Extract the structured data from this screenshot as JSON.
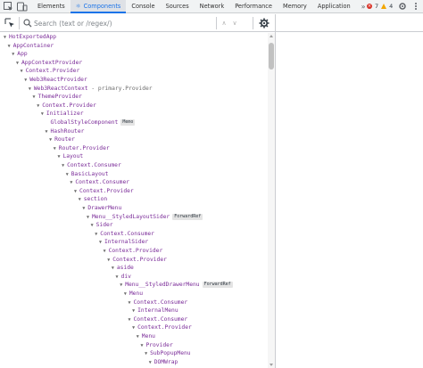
{
  "tabs": [
    {
      "label": "Elements",
      "active": false
    },
    {
      "label": "Components",
      "active": true
    },
    {
      "label": "Console",
      "active": false
    },
    {
      "label": "Sources",
      "active": false
    },
    {
      "label": "Network",
      "active": false
    },
    {
      "label": "Performance",
      "active": false
    },
    {
      "label": "Memory",
      "active": false
    },
    {
      "label": "Application",
      "active": false
    }
  ],
  "overflow_label": "»",
  "counts": {
    "errors": "7",
    "warnings": "4"
  },
  "search": {
    "placeholder": "Search (text or /regex/)",
    "value": ""
  },
  "tree": [
    {
      "name": "HotExportedApp",
      "depth": 0,
      "expanded": true
    },
    {
      "name": "AppContainer",
      "depth": 1,
      "expanded": true
    },
    {
      "name": "App",
      "depth": 2,
      "expanded": true
    },
    {
      "name": "AppContextProvider",
      "depth": 3,
      "expanded": true
    },
    {
      "name": "Context.Provider",
      "depth": 4,
      "expanded": true
    },
    {
      "name": "Web3ReactProvider",
      "depth": 5,
      "expanded": true
    },
    {
      "name": "Web3ReactContext",
      "extra": " - primary.Provider",
      "depth": 6,
      "expanded": true
    },
    {
      "name": "ThemeProvider",
      "depth": 7,
      "expanded": true
    },
    {
      "name": "Context.Provider",
      "depth": 8,
      "expanded": true
    },
    {
      "name": "Initializer",
      "depth": 9,
      "expanded": true
    },
    {
      "name": "GlobalStyleComponent",
      "badge": "Memo",
      "depth": 10,
      "expanded": false
    },
    {
      "name": "HashRouter",
      "depth": 10,
      "expanded": true
    },
    {
      "name": "Router",
      "depth": 11,
      "expanded": true
    },
    {
      "name": "Router.Provider",
      "depth": 12,
      "expanded": true
    },
    {
      "name": "Layout",
      "depth": 13,
      "expanded": true
    },
    {
      "name": "Context.Consumer",
      "depth": 14,
      "expanded": true
    },
    {
      "name": "BasicLayout",
      "depth": 15,
      "expanded": true
    },
    {
      "name": "Context.Consumer",
      "depth": 16,
      "expanded": true
    },
    {
      "name": "Context.Provider",
      "depth": 17,
      "expanded": true
    },
    {
      "name": "section",
      "depth": 18,
      "expanded": true
    },
    {
      "name": "DrawerMenu",
      "depth": 19,
      "expanded": true
    },
    {
      "name": "Menu__StyledLayoutSider",
      "badge": "ForwardRef",
      "depth": 20,
      "expanded": true
    },
    {
      "name": "Sider",
      "depth": 21,
      "expanded": true
    },
    {
      "name": "Context.Consumer",
      "depth": 22,
      "expanded": true
    },
    {
      "name": "InternalSider",
      "depth": 23,
      "expanded": true
    },
    {
      "name": "Context.Provider",
      "depth": 24,
      "expanded": true
    },
    {
      "name": "Context.Provider",
      "depth": 25,
      "expanded": true
    },
    {
      "name": "aside",
      "depth": 26,
      "expanded": true
    },
    {
      "name": "div",
      "depth": 27,
      "expanded": true
    },
    {
      "name": "Menu__StyledDrawerMenu",
      "badge": "ForwardRef",
      "depth": 28,
      "expanded": true
    },
    {
      "name": "Menu",
      "depth": 29,
      "expanded": true
    },
    {
      "name": "Context.Consumer",
      "depth": 30,
      "expanded": true
    },
    {
      "name": "InternalMenu",
      "depth": 31,
      "expanded": true
    },
    {
      "name": "Context.Consumer",
      "depth": 30,
      "expanded": true
    },
    {
      "name": "Context.Provider",
      "depth": 31,
      "expanded": true
    },
    {
      "name": "Menu",
      "depth": 32,
      "expanded": true
    },
    {
      "name": "Provider",
      "depth": 33,
      "expanded": true
    },
    {
      "name": "SubPopupMenu",
      "depth": 34,
      "expanded": true
    },
    {
      "name": "DOMWrap",
      "depth": 35,
      "expanded": true
    }
  ]
}
